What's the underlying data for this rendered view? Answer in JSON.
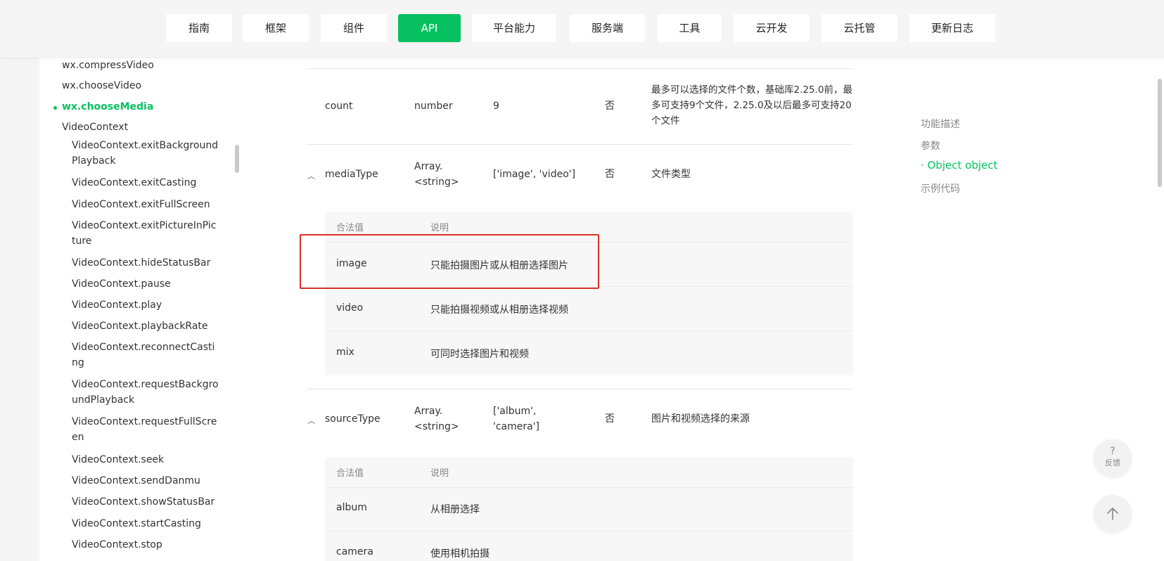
{
  "topnav": {
    "tabs": [
      {
        "label": "指南"
      },
      {
        "label": "框架"
      },
      {
        "label": "组件"
      },
      {
        "label": "API"
      },
      {
        "label": "平台能力"
      },
      {
        "label": "服务端"
      },
      {
        "label": "工具"
      },
      {
        "label": "云开发"
      },
      {
        "label": "云托管"
      },
      {
        "label": "更新日志"
      }
    ],
    "active_tab": "API",
    "accent_color": "#07c160"
  },
  "sidebar": {
    "items": [
      {
        "label": "wx.compressVideo"
      },
      {
        "label": "wx.chooseVideo"
      },
      {
        "label": "wx.chooseMedia"
      },
      {
        "label": "VideoContext"
      },
      {
        "label": "VideoContext.exitBackgroundPlayback"
      },
      {
        "label": "VideoContext.exitCasting"
      },
      {
        "label": "VideoContext.exitFullScreen"
      },
      {
        "label": "VideoContext.exitPictureInPicture"
      },
      {
        "label": "VideoContext.hideStatusBar"
      },
      {
        "label": "VideoContext.pause"
      },
      {
        "label": "VideoContext.play"
      },
      {
        "label": "VideoContext.playbackRate"
      },
      {
        "label": "VideoContext.reconnectCasting"
      },
      {
        "label": "VideoContext.requestBackgroundPlayback"
      },
      {
        "label": "VideoContext.requestFullScreen"
      },
      {
        "label": "VideoContext.seek"
      },
      {
        "label": "VideoContext.sendDanmu"
      },
      {
        "label": "VideoContext.showStatusBar"
      },
      {
        "label": "VideoContext.startCasting"
      },
      {
        "label": "VideoContext.stop"
      }
    ],
    "active_item": "wx.chooseMedia"
  },
  "params": {
    "rows": [
      {
        "name": "count",
        "type": "number",
        "default": "9",
        "required": "否",
        "desc": "最多可以选择的文件个数，基础库2.25.0前，最多可支持9个文件，2.25.0及以后最多可支持20个文件"
      },
      {
        "name": "mediaType",
        "type": "Array.<string>",
        "default": "['image', 'video']",
        "required": "否",
        "desc": "文件类型",
        "sub_header": {
          "value": "合法值",
          "desc": "说明"
        },
        "sub_rows": [
          {
            "value": "image",
            "desc": "只能拍摄图片或从相册选择图片"
          },
          {
            "value": "video",
            "desc": "只能拍摄视频或从相册选择视频"
          },
          {
            "value": "mix",
            "desc": "可同时选择图片和视频"
          }
        ]
      },
      {
        "name": "sourceType",
        "type": "Array.<string>",
        "default": "['album', 'camera']",
        "required": "否",
        "desc": "图片和视频选择的来源",
        "sub_header": {
          "value": "合法值",
          "desc": "说明"
        },
        "sub_rows": [
          {
            "value": "album",
            "desc": "从相册选择"
          },
          {
            "value": "camera",
            "desc": "使用相机拍摄"
          }
        ]
      }
    ],
    "type_split": {
      "array_prefix": "Array.",
      "array_suffix": "<string>",
      "source_default_a": "['album',",
      "source_default_b": "'camera']"
    }
  },
  "toc": {
    "items": [
      {
        "label": "功能描述"
      },
      {
        "label": "参数"
      },
      {
        "label": "· Object object"
      },
      {
        "label": "示例代码"
      }
    ],
    "active_item": "· Object object"
  },
  "floating": {
    "feedback_symbol": "?",
    "feedback_label": "反馈",
    "backtop_icon": "arrow-up-icon"
  },
  "highlight_color": "#d93025"
}
